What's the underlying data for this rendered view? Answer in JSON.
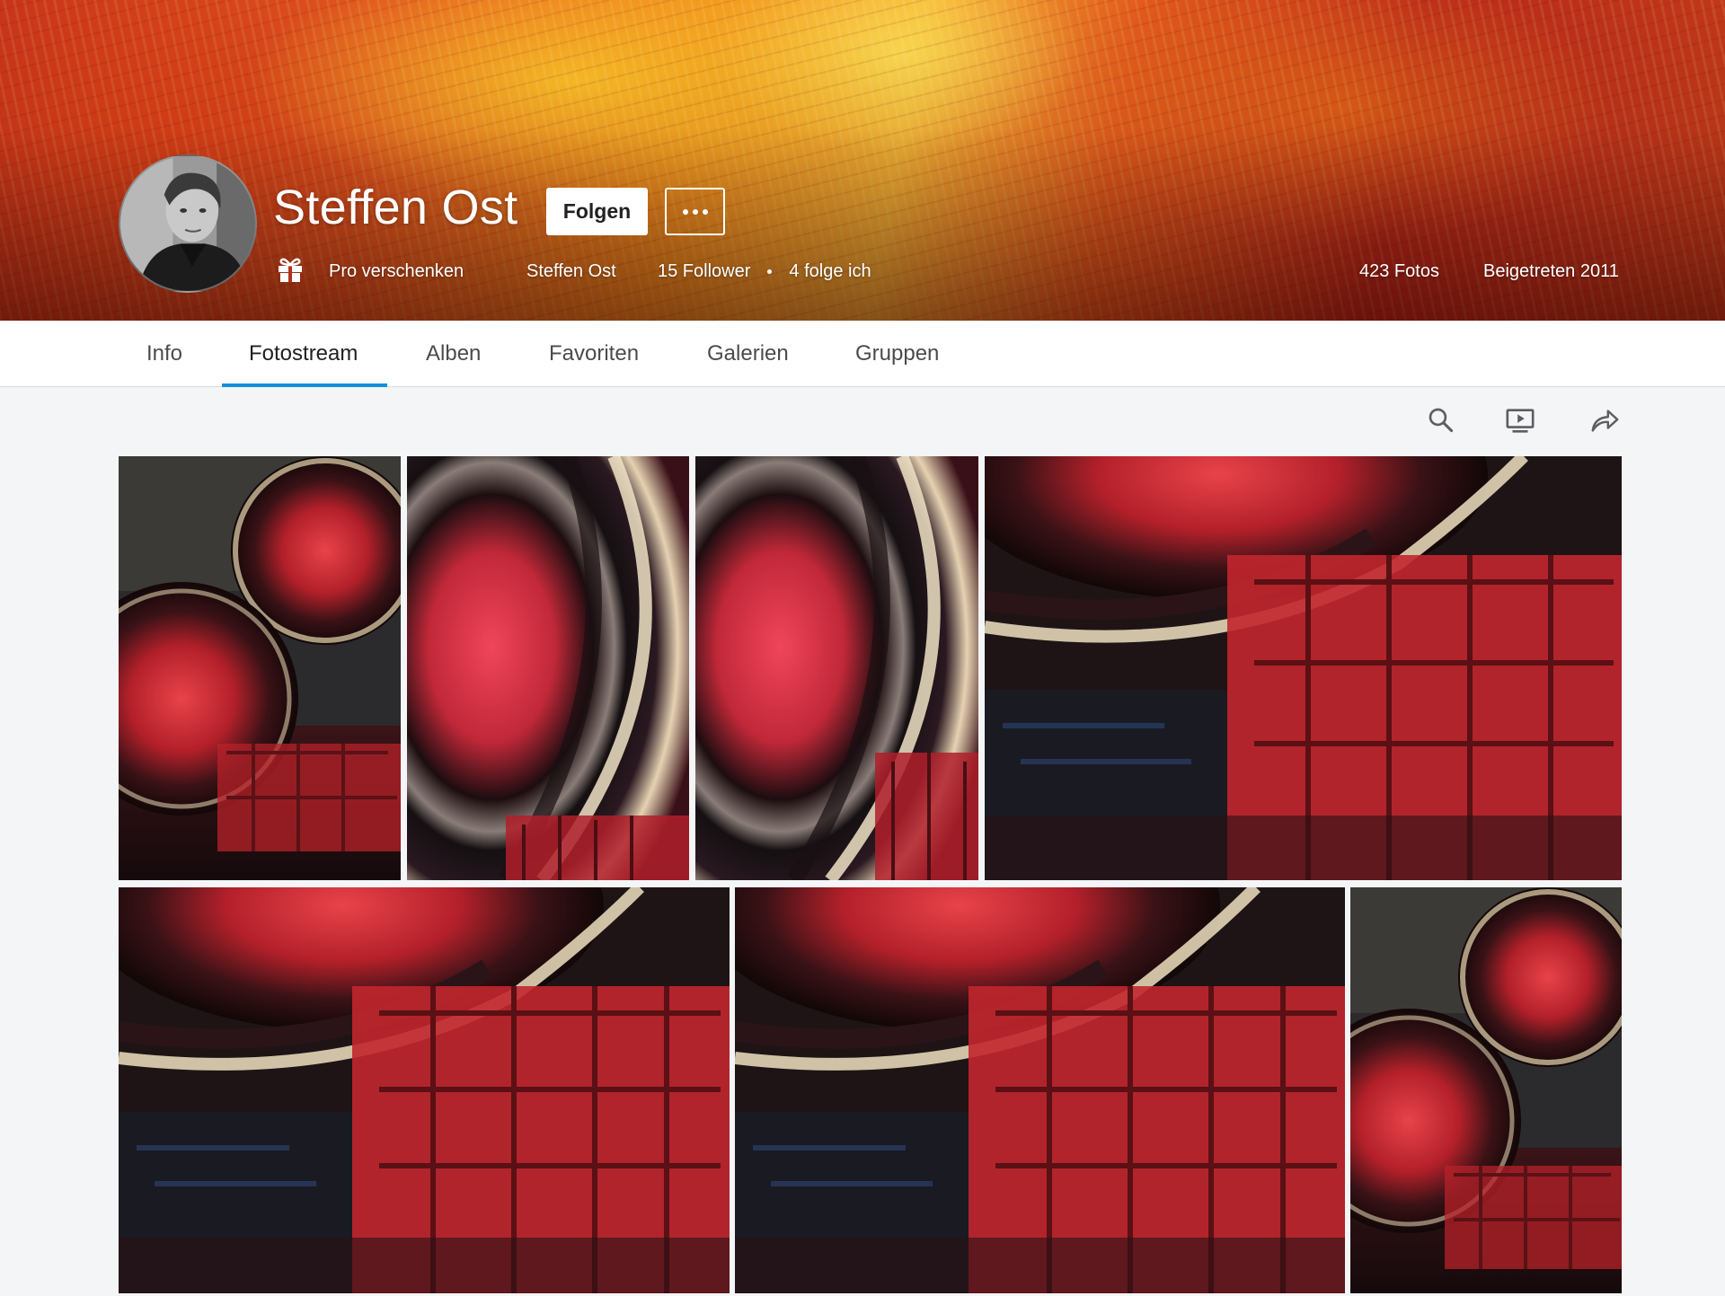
{
  "profile": {
    "name": "Steffen Ost",
    "follow_label": "Folgen",
    "more_label": "Weitere Optionen",
    "gift_label": "Pro verschenken",
    "username": "Steffen Ost",
    "followers": "15 Follower",
    "following": "4 folge ich",
    "photo_count": "423 Fotos",
    "joined": "Beigetreten 2011"
  },
  "tabs": [
    {
      "label": "Info"
    },
    {
      "label": "Fotostream",
      "active": true
    },
    {
      "label": "Alben"
    },
    {
      "label": "Favoriten"
    },
    {
      "label": "Galerien"
    },
    {
      "label": "Gruppen"
    }
  ],
  "toolbar": {
    "icons": [
      "search-icon",
      "slideshow-icon",
      "share-icon"
    ]
  },
  "photos": [
    {
      "artwork": "two-red-circles-portrait"
    },
    {
      "artwork": "swirl-closeup"
    },
    {
      "artwork": "swirl-closeup"
    },
    {
      "artwork": "red-grid-landscape"
    },
    {
      "artwork": "red-grid-landscape"
    },
    {
      "artwork": "red-grid-landscape"
    },
    {
      "artwork": "two-red-circles-portrait"
    }
  ],
  "colors": {
    "accent": "#128fdc",
    "cover_red": "#c8341a",
    "cover_orange": "#f0901e",
    "page_bg": "#f3f5f6"
  }
}
